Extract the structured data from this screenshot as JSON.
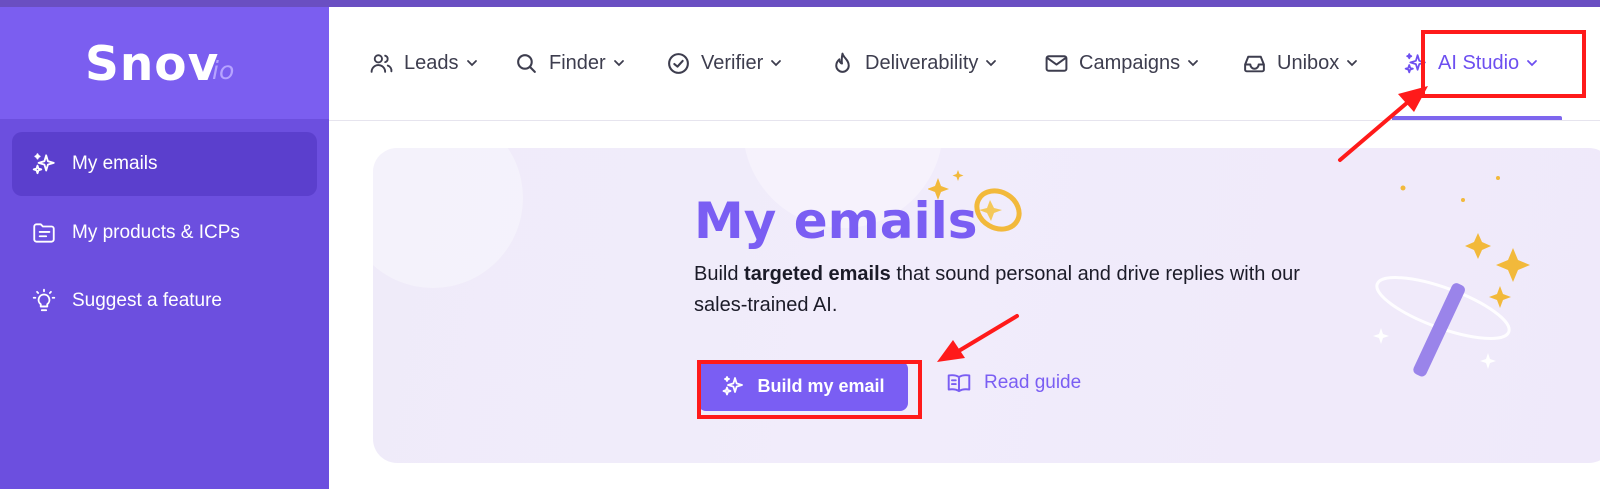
{
  "logo": {
    "name": "Snov",
    "suffix": "io"
  },
  "sidebar": {
    "items": [
      {
        "label": "My emails",
        "icon": "sparkles-icon",
        "active": true
      },
      {
        "label": "My products & ICPs",
        "icon": "folder-list-icon",
        "active": false
      },
      {
        "label": "Suggest a feature",
        "icon": "lightbulb-icon",
        "active": false
      }
    ]
  },
  "topnav": {
    "items": [
      {
        "label": "Leads",
        "icon": "users-icon"
      },
      {
        "label": "Finder",
        "icon": "search-icon"
      },
      {
        "label": "Verifier",
        "icon": "check-circle-icon"
      },
      {
        "label": "Deliverability",
        "icon": "flame-icon"
      },
      {
        "label": "Campaigns",
        "icon": "envelope-icon"
      },
      {
        "label": "Unibox",
        "icon": "inbox-icon"
      },
      {
        "label": "AI Studio",
        "icon": "sparkles-icon",
        "active": true
      }
    ]
  },
  "hero": {
    "title": "My emails",
    "desc_prefix": "Build ",
    "desc_bold": "targeted emails",
    "desc_suffix": " that sound personal and drive replies with our sales-trained AI.",
    "build_button": "Build my email",
    "read_guide": "Read guide"
  },
  "colors": {
    "accent": "#7a5ef3",
    "sidebar": "#6c4fdf",
    "annotation": "#ff1a1a"
  }
}
